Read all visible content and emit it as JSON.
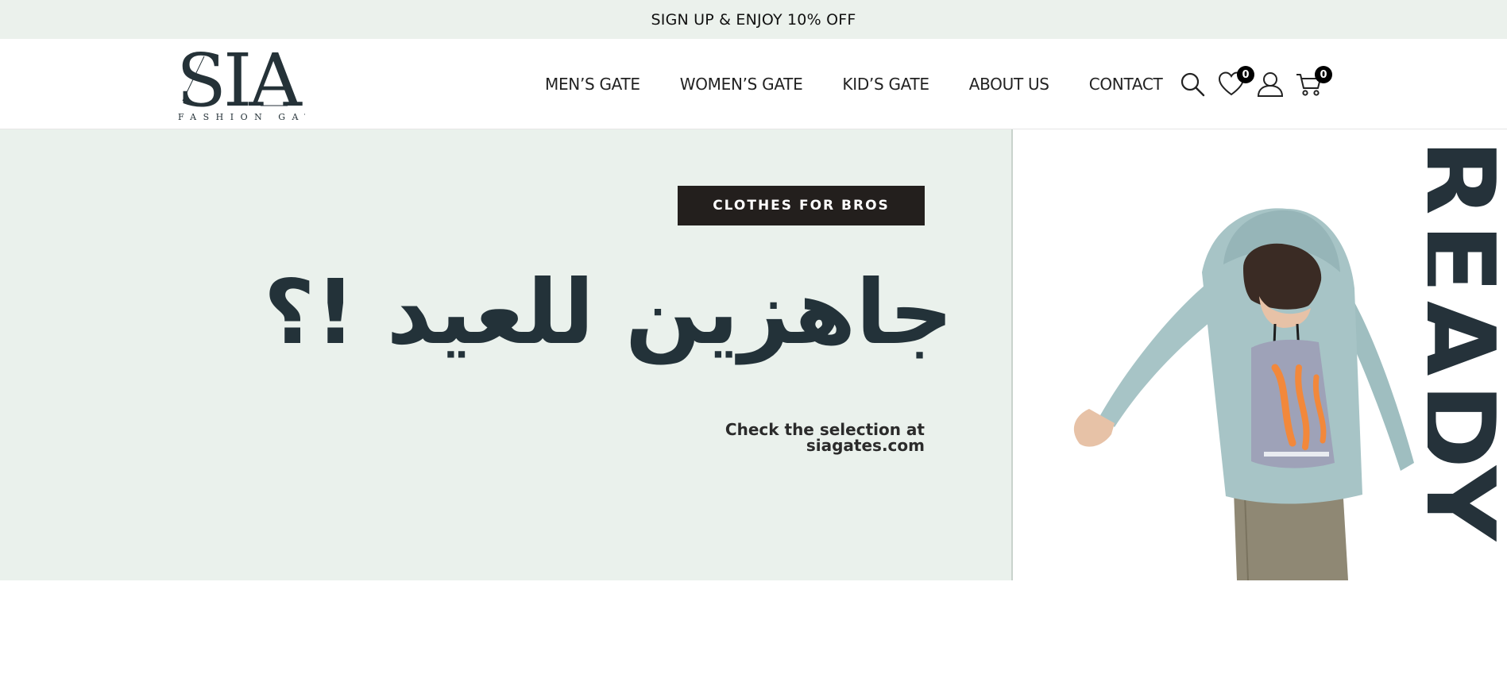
{
  "announcement": {
    "text": "SIGN UP & ENJOY 10% OFF"
  },
  "header": {
    "logo": {
      "wordmark": "SIA",
      "tagline": "FASHION GATE"
    },
    "nav": [
      {
        "label": "MEN’S GATE"
      },
      {
        "label": "WOMEN’S GATE"
      },
      {
        "label": "KID’S GATE"
      },
      {
        "label": "ABOUT US"
      },
      {
        "label": "CONTACT"
      }
    ],
    "icons": {
      "search": "search-icon",
      "wishlist": "heart-icon",
      "account": "user-icon",
      "cart": "cart-icon"
    },
    "wishlist_count": "0",
    "cart_count": "0"
  },
  "hero": {
    "pill": "CLOTHES FOR BROS",
    "headline": "جاهزين للعيد !؟",
    "subline_1": "Check the selection at",
    "subline_2": "siagates.com",
    "side_word": "READY"
  },
  "colors": {
    "announcement_bg": "#ebf1ec",
    "hero_bg": "#eaf1ec",
    "headline": "#233239",
    "pill_bg": "#231f1d",
    "hoodie": "#a7c4c6",
    "badge": "#000000"
  }
}
